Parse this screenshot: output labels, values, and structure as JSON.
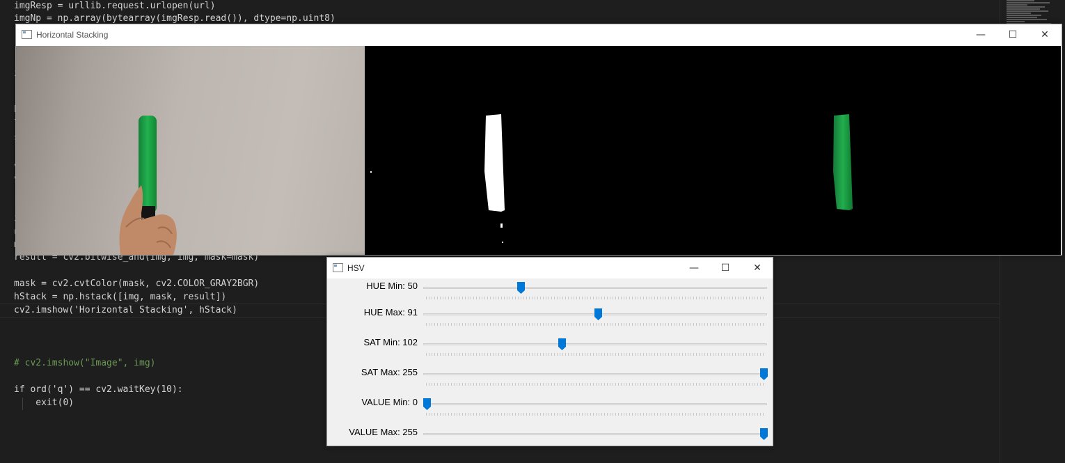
{
  "editor": {
    "lines": [
      "imgResp = urllib.request.urlopen(url)",
      "imgNp = np.array(bytearray(imgResp.read()), dtype=np.uint8)",
      "result = cv2.bitwise_and(img, img, mask=mask)",
      "mask = cv2.cvtColor(mask, cv2.COLOR_GRAY2BGR)",
      "hStack = np.hstack([img, mask, result])",
      "cv2.imshow('Horizontal Stacking', hStack)",
      "# cv2.imshow(\"Image\", img)",
      "if ord('q') == cv2.waitKey(10):",
      "    exit(0)"
    ],
    "gutter_fragments": [
      "i",
      "h",
      "l",
      "s",
      "v",
      "v",
      "i",
      "u",
      "m"
    ],
    "colors": {
      "background": "#1e1e1e",
      "text": "#d4d4d4",
      "function": "#dcdcaa",
      "string": "#ce9178",
      "keyword": "#c586c0",
      "comment": "#6a9955",
      "variable": "#9cdcfe"
    }
  },
  "stack_window": {
    "title": "Horizontal Stacking",
    "controls": {
      "minimize": "—",
      "maximize": "☐",
      "close": "✕"
    },
    "panes": [
      "original-image",
      "mask",
      "result"
    ],
    "marker_color": "#1fa046"
  },
  "hsv_window": {
    "title": "HSV",
    "controls": {
      "minimize": "—",
      "maximize": "☐",
      "close": "✕"
    },
    "thumb_color": "#0078d7",
    "trackbars": [
      {
        "label": "HUE Min: 50",
        "value": 50,
        "max": 179
      },
      {
        "label": "HUE Max: 91",
        "value": 91,
        "max": 179
      },
      {
        "label": "SAT Min: 102",
        "value": 102,
        "max": 255
      },
      {
        "label": "SAT Max: 255",
        "value": 255,
        "max": 255
      },
      {
        "label": "VALUE Min: 0",
        "value": 0,
        "max": 255
      },
      {
        "label": "VALUE Max: 255",
        "value": 255,
        "max": 255
      }
    ]
  }
}
